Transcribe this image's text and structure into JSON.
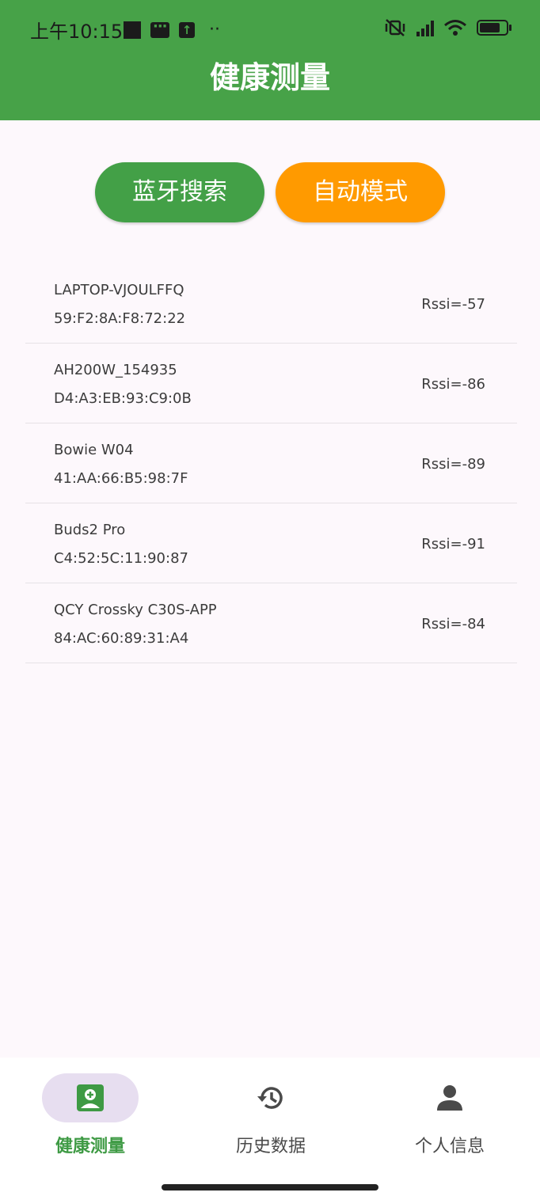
{
  "status_bar": {
    "time": "上午10:15"
  },
  "app_bar": {
    "title": "健康测量"
  },
  "buttons": {
    "bluetooth_search": "蓝牙搜索",
    "auto_mode": "自动模式"
  },
  "devices": [
    {
      "name": "LAPTOP-VJOULFFQ",
      "mac": "59:F2:8A:F8:72:22",
      "rssi": "Rssi=-57"
    },
    {
      "name": "AH200W_154935",
      "mac": "D4:A3:EB:93:C9:0B",
      "rssi": "Rssi=-86"
    },
    {
      "name": "Bowie W04",
      "mac": "41:AA:66:B5:98:7F",
      "rssi": "Rssi=-89"
    },
    {
      "name": "Buds2 Pro",
      "mac": "C4:52:5C:11:90:87",
      "rssi": "Rssi=-91"
    },
    {
      "name": "QCY Crossky C30S-APP",
      "mac": "84:AC:60:89:31:A4",
      "rssi": "Rssi=-84"
    }
  ],
  "bottom_nav": {
    "items": [
      {
        "label": "健康测量",
        "icon": "health-card-icon",
        "selected": true
      },
      {
        "label": "历史数据",
        "icon": "history-icon",
        "selected": false
      },
      {
        "label": "个人信息",
        "icon": "person-icon",
        "selected": false
      }
    ]
  },
  "colors": {
    "primary": "#47a248",
    "accent": "#ff9a00",
    "nav_selected_bg": "#e7def0"
  }
}
